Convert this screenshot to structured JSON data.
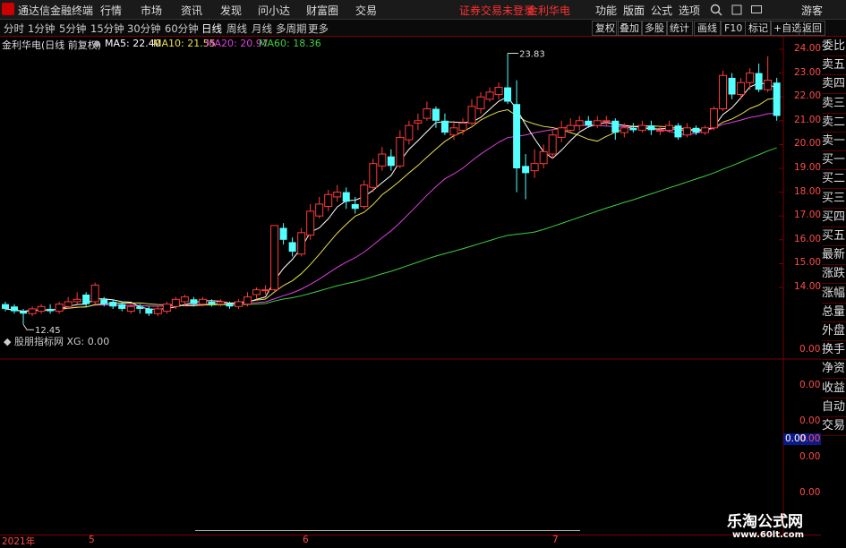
{
  "app": {
    "title": "通达信金融终端",
    "menu": [
      "行情",
      "市场",
      "资讯",
      "发现",
      "问小达",
      "财富圈",
      "交易"
    ],
    "notice": "证券交易未登录",
    "stock_name_top": "金利华电",
    "right_menu": [
      "功能",
      "版面",
      "公式",
      "选项"
    ],
    "guest": "游客"
  },
  "toolbar": {
    "periods": [
      "分时",
      "1分钟",
      "5分钟",
      "15分钟",
      "30分钟",
      "60分钟",
      "日线",
      "周线",
      "月线",
      "多周期",
      "更多"
    ],
    "active": "日线",
    "right_buttons": [
      "复权",
      "叠加",
      "多股",
      "统计",
      "画线",
      "F10",
      "标记",
      "+自选",
      "返回"
    ]
  },
  "chart_info": {
    "title": "金利华电(日线 前复权)",
    "ma": [
      {
        "label": "MA5: 22.40",
        "color": "#ffffff"
      },
      {
        "label": "MA10: 21.55",
        "color": "#e8e04a"
      },
      {
        "label": "MA20: 20.97",
        "color": "#e040e0"
      },
      {
        "label": "MA60: 18.36",
        "color": "#3ecf3e"
      }
    ],
    "indicator": "股朋指标网 XG: 0.00",
    "high_label": "23.83",
    "low_label": "12.45"
  },
  "price_axis": [
    "24.00",
    "23.00",
    "22.00",
    "21.00",
    "20.00",
    "19.00",
    "18.00",
    "17.00",
    "16.00",
    "15.00",
    "14.00"
  ],
  "indicator_axis": [
    "0.00",
    "0.00",
    "0.00",
    "0.00",
    "0.00",
    "0.00"
  ],
  "indicator_highlight": "0.00",
  "date_axis": [
    "2021年",
    "5",
    "6",
    "7"
  ],
  "side_panel": [
    "委比",
    "卖五",
    "卖四",
    "卖三",
    "卖二",
    "卖一",
    "买一",
    "买二",
    "买三",
    "买四",
    "买五",
    "最新",
    "涨跌",
    "涨幅",
    "总量",
    "外盘",
    "换手",
    "净资",
    "收益",
    "自动",
    "交易"
  ],
  "watermark": {
    "line1": "乐淘公式网",
    "line2": "www.60lt.com"
  },
  "colors": {
    "up": "#ff3a3a",
    "down": "#54ffff",
    "ma5": "#ffffff",
    "ma10": "#e8e04a",
    "ma20": "#e040e0",
    "ma60": "#3ecf3e",
    "grid": "#7a0000"
  },
  "chart_data": {
    "type": "candlestick",
    "title": "金利华电(日线 前复权)",
    "ylim": [
      12.0,
      24.5
    ],
    "x_ticks": [
      "2021年",
      "5",
      "6",
      "7"
    ],
    "candles": [
      [
        13.3,
        13.1,
        13.4,
        13.0
      ],
      [
        13.2,
        13.0,
        13.3,
        12.9
      ],
      [
        13.0,
        12.9,
        13.1,
        12.45
      ],
      [
        12.9,
        13.1,
        13.2,
        12.8
      ],
      [
        13.0,
        13.2,
        13.3,
        12.9
      ],
      [
        13.1,
        13.0,
        13.3,
        12.9
      ],
      [
        13.0,
        13.3,
        13.4,
        12.9
      ],
      [
        13.2,
        13.4,
        13.6,
        13.1
      ],
      [
        13.4,
        13.5,
        13.8,
        13.3
      ],
      [
        13.7,
        13.3,
        13.8,
        13.2
      ],
      [
        13.4,
        14.1,
        14.2,
        13.3
      ],
      [
        13.5,
        13.3,
        13.6,
        13.2
      ],
      [
        13.4,
        13.2,
        13.5,
        13.1
      ],
      [
        13.3,
        13.1,
        13.4,
        13.0
      ],
      [
        13.0,
        13.2,
        13.3,
        12.9
      ],
      [
        13.2,
        13.1,
        13.3,
        12.9
      ],
      [
        13.1,
        12.9,
        13.2,
        12.8
      ],
      [
        12.9,
        13.1,
        13.2,
        12.8
      ],
      [
        13.0,
        13.3,
        13.4,
        12.9
      ],
      [
        13.2,
        13.5,
        13.6,
        13.1
      ],
      [
        13.4,
        13.6,
        13.7,
        13.2
      ],
      [
        13.5,
        13.3,
        13.6,
        13.2
      ],
      [
        13.3,
        13.5,
        13.6,
        13.2
      ],
      [
        13.4,
        13.3,
        13.5,
        13.2
      ],
      [
        13.3,
        13.4,
        13.5,
        13.2
      ],
      [
        13.3,
        13.2,
        13.4,
        13.1
      ],
      [
        13.2,
        13.4,
        13.5,
        13.1
      ],
      [
        13.3,
        13.6,
        13.8,
        13.2
      ],
      [
        13.7,
        13.9,
        14.0,
        13.5
      ],
      [
        13.9,
        13.9,
        14.1,
        13.7
      ],
      [
        13.9,
        16.6,
        16.6,
        13.8
      ],
      [
        16.5,
        16.0,
        16.7,
        15.8
      ],
      [
        15.9,
        15.5,
        16.1,
        15.3
      ],
      [
        15.4,
        16.3,
        16.5,
        15.3
      ],
      [
        16.2,
        17.2,
        17.5,
        16.0
      ],
      [
        17.0,
        17.5,
        17.8,
        16.9
      ],
      [
        17.4,
        17.9,
        18.1,
        17.2
      ],
      [
        17.8,
        18.0,
        18.3,
        17.6
      ],
      [
        18.0,
        17.6,
        18.2,
        17.3
      ],
      [
        17.5,
        17.3,
        17.8,
        17.1
      ],
      [
        17.4,
        18.3,
        18.5,
        17.3
      ],
      [
        18.2,
        19.2,
        19.4,
        18.0
      ],
      [
        19.1,
        19.6,
        19.9,
        18.9
      ],
      [
        19.5,
        19.1,
        19.8,
        18.9
      ],
      [
        19.1,
        20.3,
        20.6,
        19.0
      ],
      [
        20.2,
        20.8,
        21.0,
        20.0
      ],
      [
        20.9,
        21.0,
        21.3,
        20.6
      ],
      [
        21.1,
        21.5,
        21.8,
        21.0
      ],
      [
        21.5,
        21.0,
        21.6,
        20.7
      ],
      [
        21.0,
        20.5,
        21.3,
        20.4
      ],
      [
        20.4,
        20.7,
        21.0,
        20.2
      ],
      [
        20.6,
        20.9,
        21.1,
        20.4
      ],
      [
        20.9,
        21.6,
        21.9,
        20.8
      ],
      [
        21.5,
        22.0,
        22.2,
        21.3
      ],
      [
        21.9,
        22.2,
        22.4,
        21.8
      ],
      [
        22.1,
        22.4,
        22.6,
        21.9
      ],
      [
        22.4,
        21.8,
        23.83,
        21.7
      ],
      [
        21.7,
        19.0,
        22.7,
        18.0
      ],
      [
        19.1,
        18.8,
        19.6,
        17.7
      ],
      [
        18.9,
        19.2,
        19.8,
        18.6
      ],
      [
        19.2,
        19.7,
        20.0,
        19.0
      ],
      [
        19.6,
        20.4,
        20.6,
        19.4
      ],
      [
        20.3,
        20.7,
        21.0,
        20.1
      ],
      [
        20.6,
        20.8,
        21.1,
        20.5
      ],
      [
        20.8,
        21.0,
        21.2,
        20.6
      ],
      [
        21.0,
        20.8,
        21.2,
        20.7
      ],
      [
        20.8,
        21.0,
        21.2,
        20.7
      ],
      [
        21.0,
        21.0,
        21.2,
        20.8
      ],
      [
        21.0,
        20.5,
        21.1,
        20.2
      ],
      [
        20.5,
        20.7,
        20.9,
        20.3
      ],
      [
        20.7,
        20.6,
        20.9,
        20.5
      ],
      [
        20.6,
        20.8,
        21.0,
        20.5
      ],
      [
        20.8,
        20.6,
        21.0,
        20.4
      ],
      [
        20.6,
        20.6,
        20.8,
        20.4
      ],
      [
        20.6,
        20.8,
        21.0,
        20.5
      ],
      [
        20.8,
        20.3,
        20.9,
        20.2
      ],
      [
        20.4,
        20.7,
        20.9,
        20.3
      ],
      [
        20.7,
        20.5,
        20.8,
        20.4
      ],
      [
        20.5,
        20.7,
        20.8,
        20.4
      ],
      [
        20.7,
        21.5,
        21.6,
        20.6
      ],
      [
        21.5,
        22.9,
        23.1,
        21.4
      ],
      [
        22.8,
        22.1,
        23.0,
        21.9
      ],
      [
        22.1,
        22.6,
        22.8,
        21.9
      ],
      [
        22.6,
        23.0,
        23.2,
        22.3
      ],
      [
        23.0,
        22.3,
        23.4,
        22.2
      ],
      [
        22.3,
        22.7,
        23.7,
        22.2
      ],
      [
        22.6,
        21.2,
        22.8,
        21.0
      ]
    ],
    "ma_values": {
      "MA5": 22.4,
      "MA10": 21.55,
      "MA20": 20.97,
      "MA60": 18.36
    },
    "xg": 0.0
  }
}
